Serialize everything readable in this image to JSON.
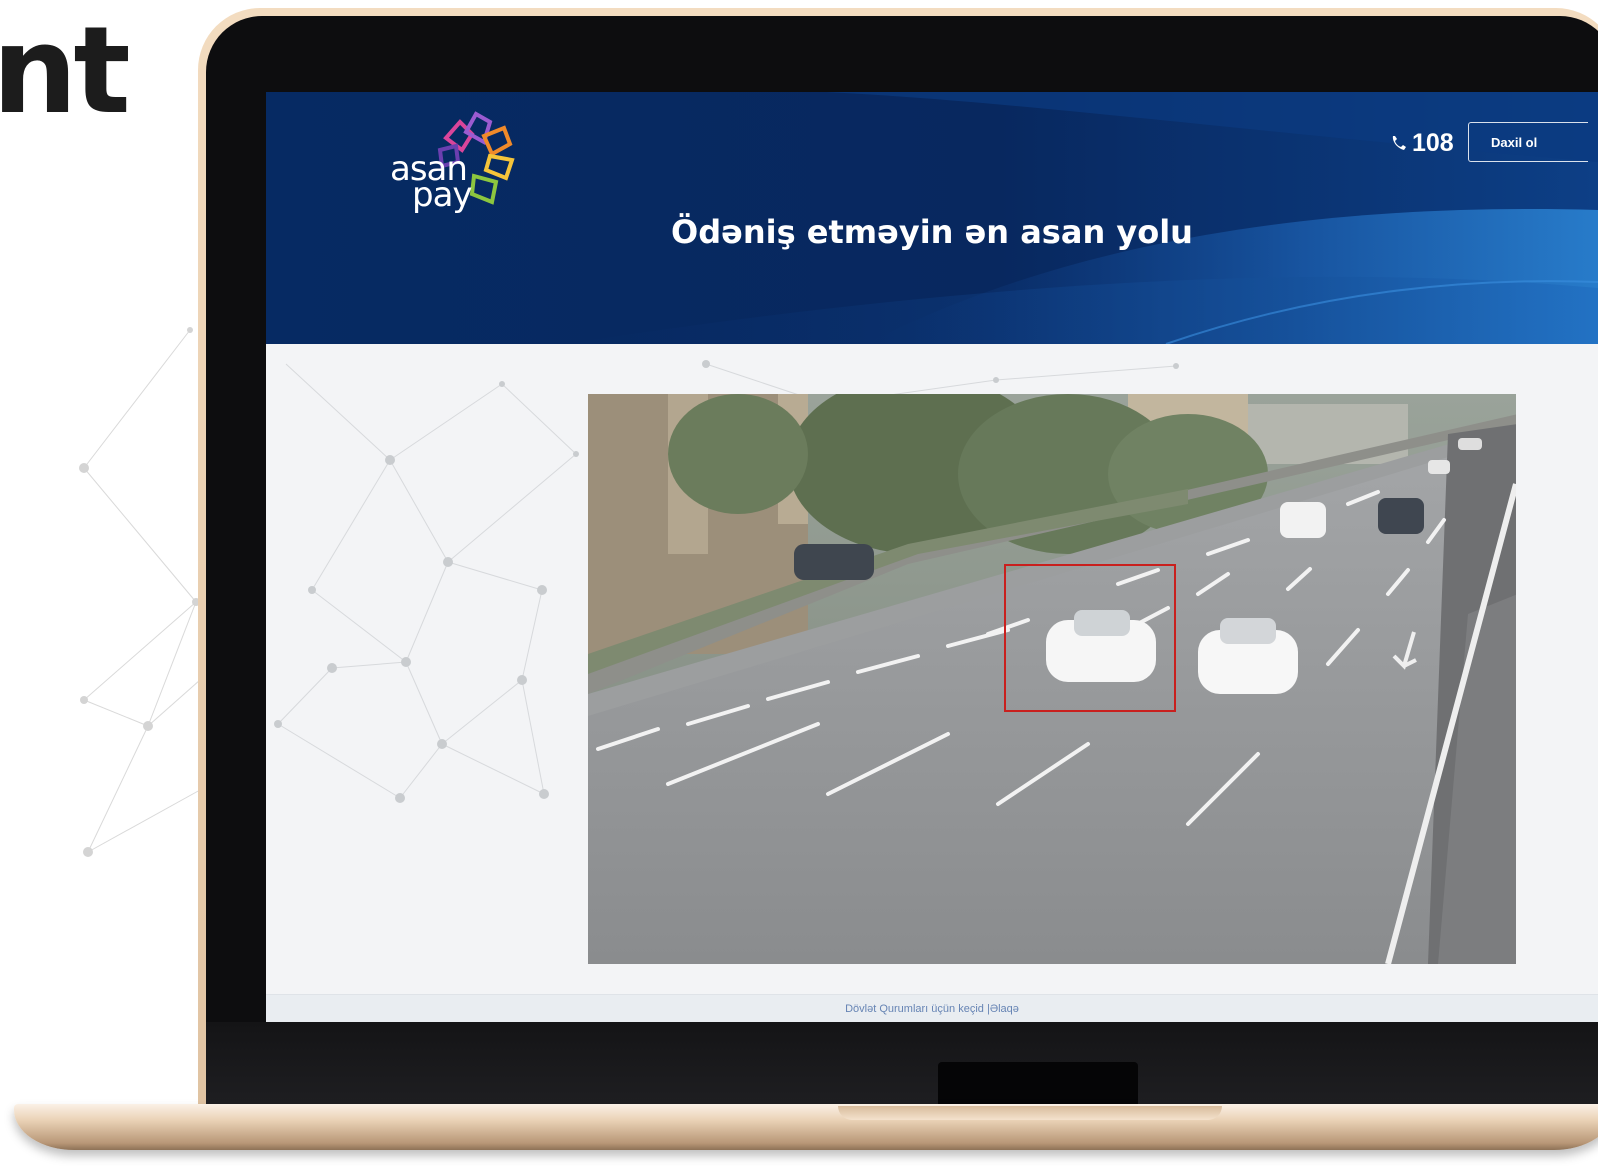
{
  "page": {
    "partial_heading": "nt"
  },
  "header": {
    "logo_line1": "asan",
    "logo_line2": "pay",
    "phone_number": "108",
    "login_label": "Daxil ol",
    "hero_title": "Ödəniş etməyin ən asan yolu"
  },
  "camera": {
    "icon": "traffic-camera-frame",
    "detection_color": "#c9201e"
  },
  "footer": {
    "link_gov": "Dövlət Qurumları üçün keçid",
    "separator": "|",
    "link_contact": "Əlaqə"
  },
  "colors": {
    "header_dark": "#08285f",
    "header_light": "#1d6dc2",
    "footer_link": "#6684b4",
    "laptop_gold": "#e0c3a2"
  }
}
